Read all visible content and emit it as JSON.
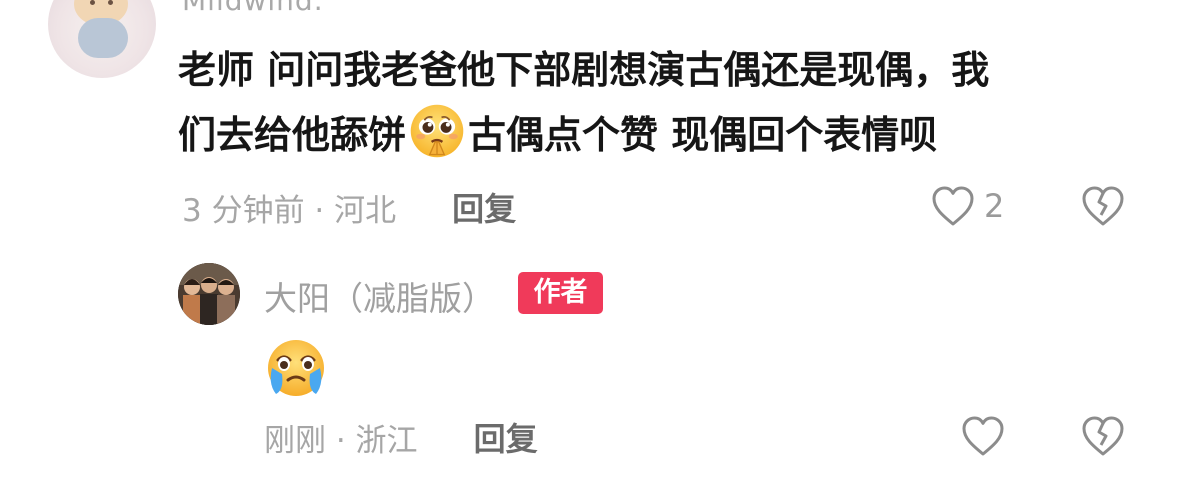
{
  "comment": {
    "username": "Mildwind.",
    "text_line1": "老师 问问我老爸他下部剧想演古偶还是现偶，我",
    "text_line2_part1": "们去给他舔饼",
    "text_line2_part2": "古偶点个赞 现偶回个表情呗",
    "inline_emoji": "pleading-face-icon",
    "time_location": "3 分钟前 · 河北",
    "reply_label": "回复",
    "like_count": "2"
  },
  "reply": {
    "username": "大阳（减脂版）",
    "badge": "作者",
    "emoji": "crying-face-icon",
    "time_location": "刚刚 · 浙江",
    "reply_label": "回复"
  },
  "colors": {
    "text_primary": "#161616",
    "text_secondary": "#a6a6a6",
    "reply_button": "#6b6b6b",
    "icon_stroke": "#8c8c8c",
    "author_badge": "#f03a5a"
  }
}
